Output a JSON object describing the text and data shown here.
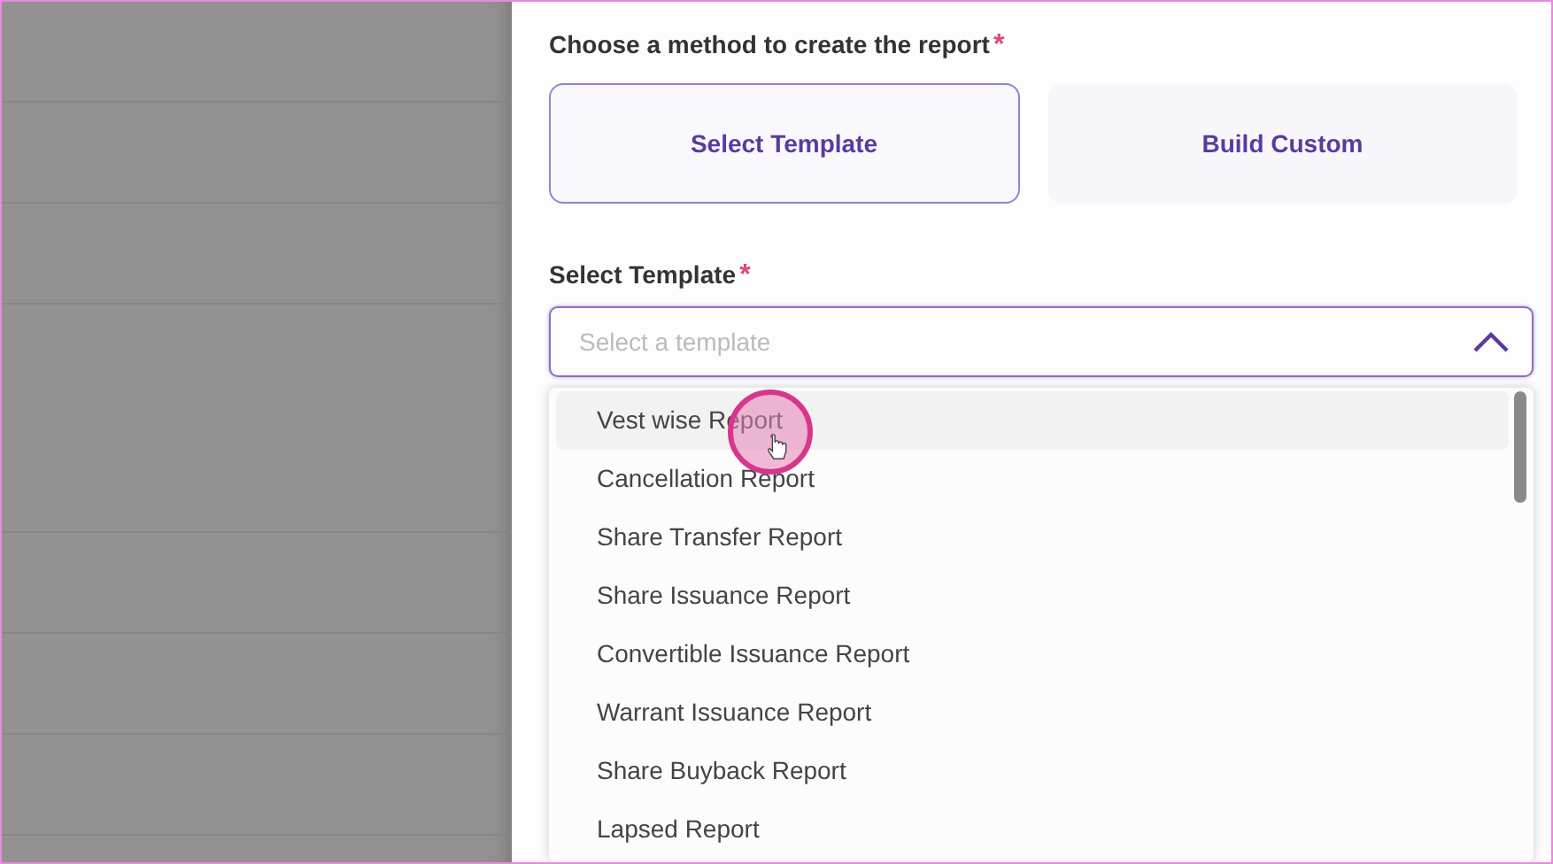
{
  "form": {
    "heading": "Choose a method to create the report",
    "heading_required_mark": "*",
    "methods": [
      {
        "label": "Select Template",
        "selected": true
      },
      {
        "label": "Build Custom",
        "selected": false
      }
    ],
    "template_field": {
      "label": "Select Template",
      "required_mark": "*",
      "placeholder": "Select a template",
      "expanded": true
    },
    "options": [
      {
        "label": "Vest wise Report",
        "highlighted": true
      },
      {
        "label": "Cancellation Report",
        "highlighted": false
      },
      {
        "label": "Share Transfer Report",
        "highlighted": false
      },
      {
        "label": "Share Issuance Report",
        "highlighted": false
      },
      {
        "label": "Convertible Issuance Report",
        "highlighted": false
      },
      {
        "label": "Warrant Issuance Report",
        "highlighted": false
      },
      {
        "label": "Share Buyback Report",
        "highlighted": false
      },
      {
        "label": "Lapsed Report",
        "highlighted": false
      }
    ]
  }
}
